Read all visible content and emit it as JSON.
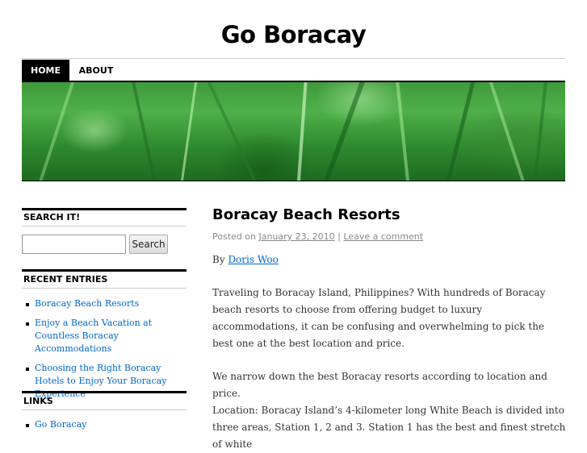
{
  "site": {
    "title": "Go Boracay"
  },
  "nav": {
    "items": [
      {
        "label": "HOME"
      },
      {
        "label": "ABOUT"
      }
    ]
  },
  "sidebar": {
    "search": {
      "title": "SEARCH IT!",
      "button_label": "Search",
      "value": ""
    },
    "recent": {
      "title": "RECENT ENTRIES",
      "items": [
        "Boracay Beach Resorts",
        "Enjoy a Beach Vacation at Countless Boracay Accommodations",
        "Choosing the Right Boracay Hotels to Enjoy Your Boracay Experience"
      ]
    },
    "links": {
      "title": "LINKS",
      "items": [
        "Go Boracay"
      ]
    }
  },
  "post": {
    "title": "Boracay Beach Resorts",
    "meta_prefix": "Posted on",
    "date": "January 23, 2010",
    "separator": "|",
    "comment_link": "Leave a comment",
    "by_prefix": "By",
    "author": "Doris Woo",
    "paragraphs": [
      "Traveling to Boracay Island, Philippines? With hundreds of Boracay beach resorts to choose from offering budget to luxury accommodations, it can be confusing and overwhelming to pick the best one at the best location and price.",
      "We narrow down the best Boracay resorts according to location and price.",
      "Location: Boracay Island’s 4-kilometer long White Beach is divided into three areas, Station 1, 2 and 3. Station 1 has the best and finest stretch of white"
    ]
  },
  "colors": {
    "link": "#0066cc",
    "nav_active_bg": "#000000",
    "header_green": "#3f9a3a"
  }
}
